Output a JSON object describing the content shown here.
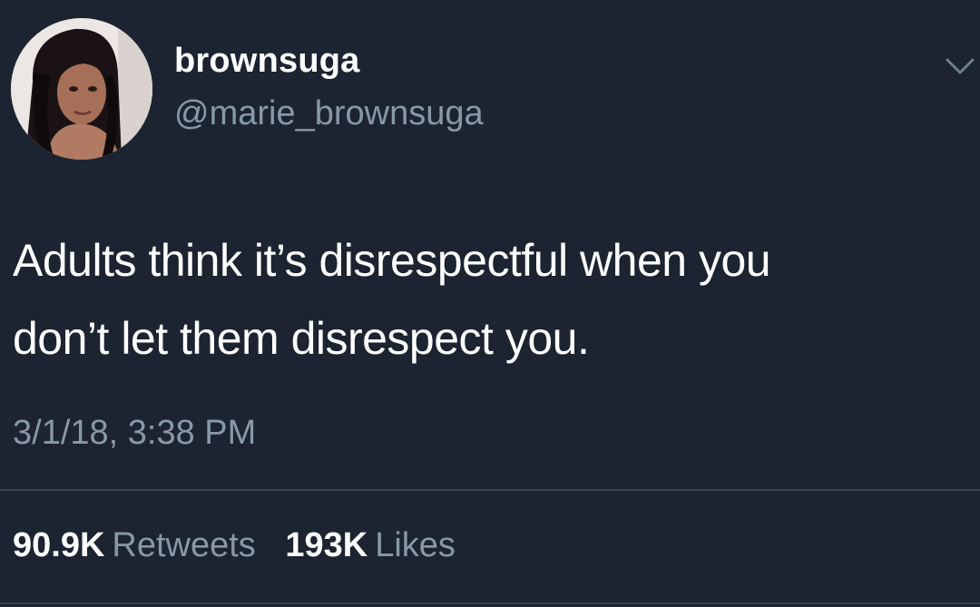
{
  "user": {
    "display_name": "brownsuga",
    "handle": "@marie_brownsuga",
    "avatar": "profile-photo"
  },
  "tweet": {
    "text_lines": [
      "Adults think it’s disrespectful when you",
      "don’t let them disrespect you."
    ],
    "timestamp": "3/1/18, 3:38 PM"
  },
  "stats": {
    "retweets_count": "90.9K",
    "retweets_label": "Retweets",
    "likes_count": "193K",
    "likes_label": "Likes"
  },
  "icons": {
    "menu": "chevron-down-icon"
  },
  "colors": {
    "background": "#1b2430",
    "primary_text": "#ffffff",
    "secondary_text": "#8899a6",
    "divider": "#38444d"
  }
}
